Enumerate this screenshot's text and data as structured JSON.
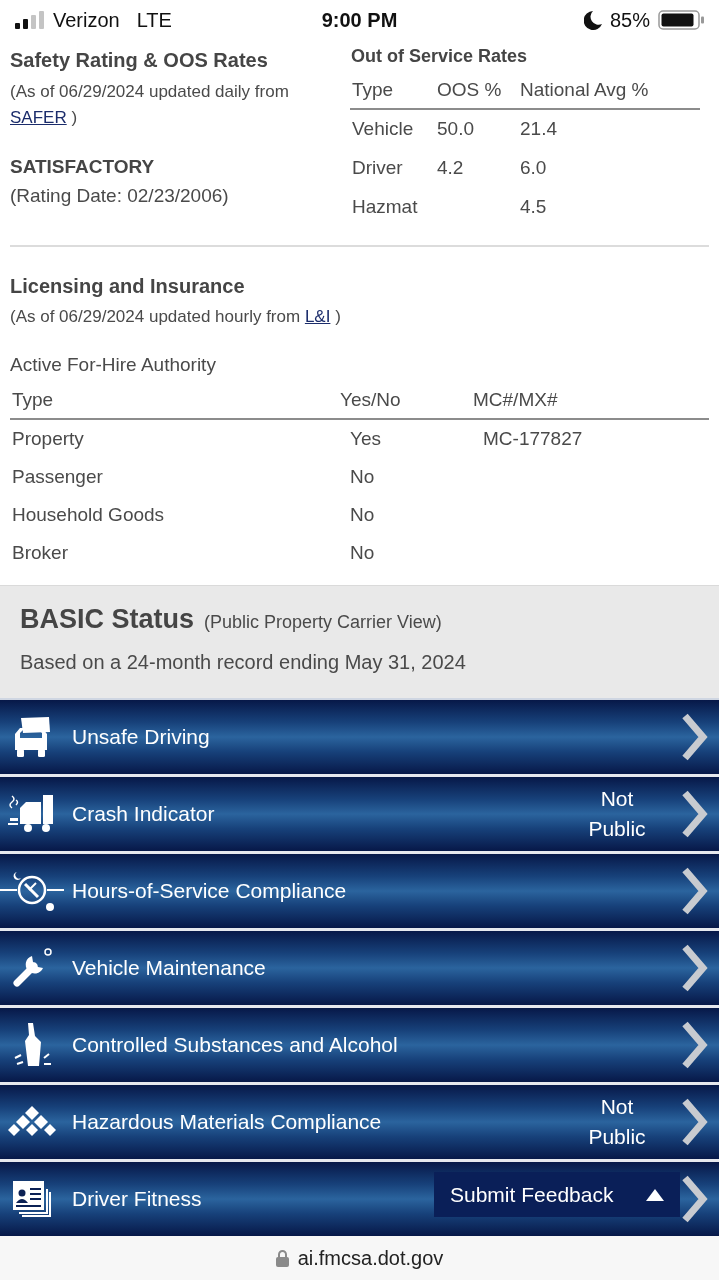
{
  "status_bar": {
    "carrier": "Verizon",
    "network": "LTE",
    "time": "9:00 PM",
    "battery": "85%"
  },
  "safety_rating": {
    "title": "Safety Rating & OOS Rates",
    "note": "(As of 06/29/2024 updated daily from",
    "link": "SAFER",
    "note_end": ")",
    "rating": "SATISFACTORY",
    "rating_date": "(Rating Date: 02/23/2006)"
  },
  "oos_rates": {
    "title": "Out of Service Rates",
    "columns": [
      "Type",
      "OOS %",
      "National Avg %"
    ],
    "rows": [
      {
        "type": "Vehicle",
        "oos": "50.0",
        "national_avg": "21.4"
      },
      {
        "type": "Driver",
        "oos": "4.2",
        "national_avg": "6.0"
      },
      {
        "type": "Hazmat",
        "national_avg": "4.5"
      }
    ]
  },
  "licensing": {
    "title": "Licensing and Insurance",
    "note": "(As of 06/29/2024 updated hourly from",
    "link": "L&I",
    "note_end": ")",
    "authority_title": "Active For-Hire Authority",
    "columns": [
      "Type",
      "Yes/No",
      "MC#/MX#"
    ],
    "rows": [
      {
        "type": "Property",
        "active": "Yes",
        "number": "MC-177827"
      },
      {
        "type": "Passenger",
        "active": "No"
      },
      {
        "type": "Household Goods",
        "active": "No"
      },
      {
        "type": "Broker",
        "active": "No"
      }
    ]
  },
  "basic_status": {
    "title": "BASIC Status",
    "subtitle": "(Public Property Carrier View)",
    "note": "Based on a 24-month record ending May 31, 2024",
    "items": [
      {
        "kind": "driving",
        "label": "Unsafe Driving"
      },
      {
        "kind": "crash",
        "label": "Crash Indicator",
        "status": "Not Public"
      },
      {
        "kind": "hours",
        "label": "Hours-of-Service Compliance"
      },
      {
        "kind": "maintenance",
        "label": "Vehicle Maintenance"
      },
      {
        "kind": "substances",
        "label": "Controlled Substances and Alcohol"
      },
      {
        "kind": "hazmat",
        "label": "Hazardous Materials Compliance",
        "status": "Not Public"
      },
      {
        "kind": "fitness",
        "label": "Driver Fitness"
      }
    ]
  },
  "feedback_button": {
    "label": "Submit Feedback"
  },
  "url_bar": {
    "url": "ai.fmcsa.dot.gov"
  }
}
